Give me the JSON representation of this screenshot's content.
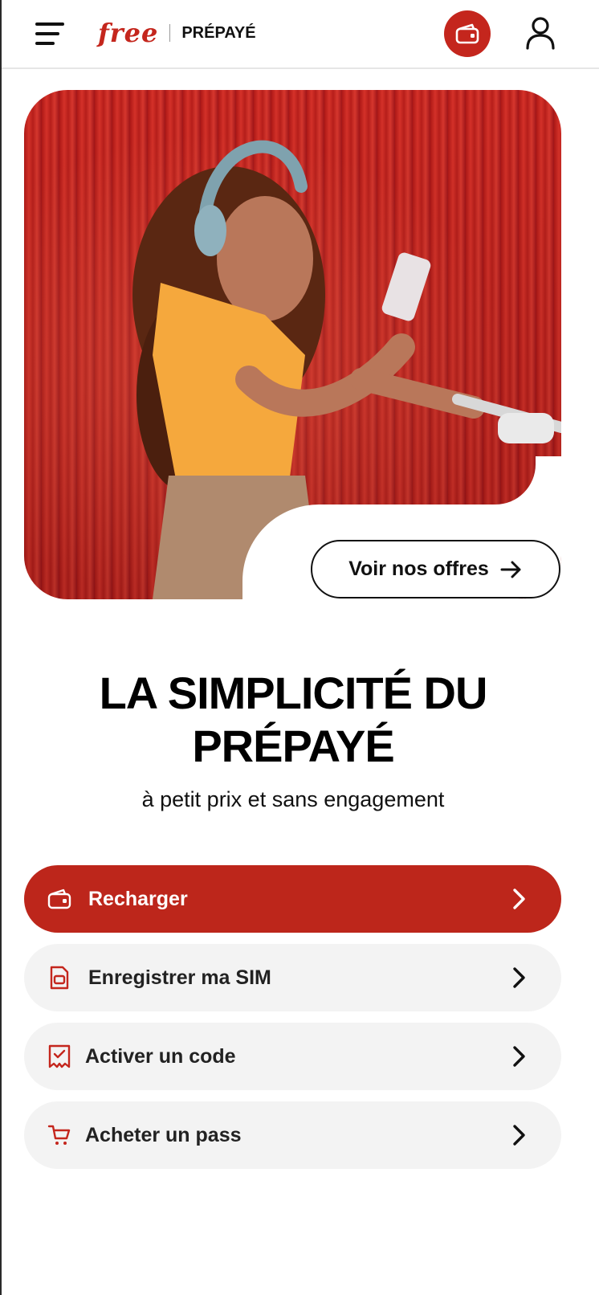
{
  "header": {
    "logo_brand": "free",
    "logo_product": "PRÉPAYÉ",
    "icons": {
      "menu": "hamburger-menu-icon",
      "wallet": "wallet-icon",
      "account": "user-icon"
    }
  },
  "hero": {
    "image_alt": "",
    "offers_button": "Voir nos offres"
  },
  "headline": {
    "line1": "LA SIMPLICITÉ DU",
    "line2": "PRÉPAYÉ",
    "subtitle": "à petit prix et sans engagement"
  },
  "actions": [
    {
      "label": "Recharger",
      "icon": "wallet-icon"
    },
    {
      "label": "Enregistrer ma SIM",
      "icon": "sim-card-icon"
    },
    {
      "label": "Activer un code",
      "icon": "ticket-check-icon"
    },
    {
      "label": "Acheter un pass",
      "icon": "cart-icon"
    }
  ],
  "colors": {
    "brand_red": "#bd261b",
    "secondary_bg": "#f3f3f3",
    "text": "#111111"
  }
}
